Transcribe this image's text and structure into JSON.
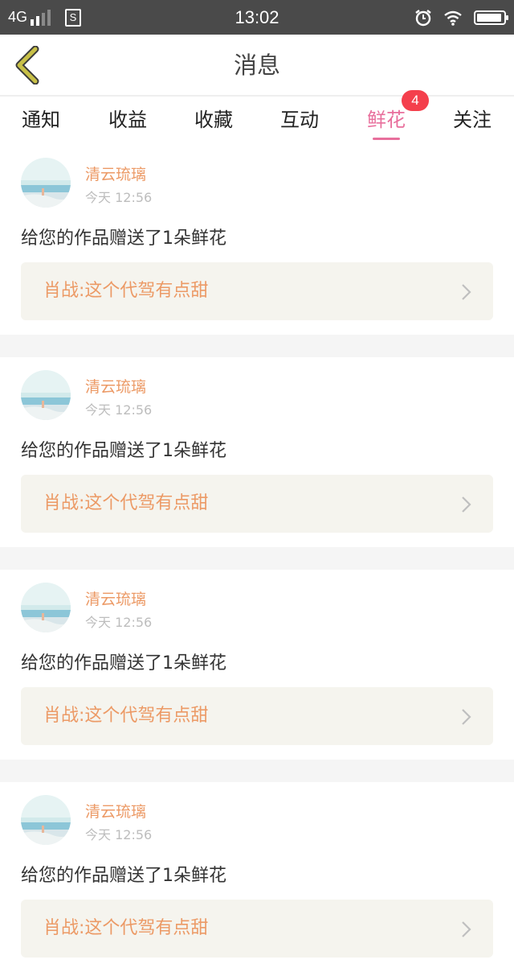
{
  "status_bar": {
    "network": "4G",
    "sim_label": "S",
    "time": "13:02",
    "icons": [
      "signal-icon",
      "sim-icon",
      "alarm-icon",
      "wifi-icon",
      "battery-icon"
    ],
    "battery_level": 0.95
  },
  "header": {
    "title": "消息",
    "back_icon": "chevron-left-icon",
    "back_color": "#c8c047"
  },
  "tabs": [
    {
      "label": "通知"
    },
    {
      "label": "收益"
    },
    {
      "label": "收藏"
    },
    {
      "label": "互动"
    },
    {
      "label": "鲜花",
      "badge": "4",
      "active": true
    },
    {
      "label": "关注"
    }
  ],
  "colors": {
    "accent": "#e86f9c",
    "badge": "#f43f4c",
    "username": "#ec9a66",
    "link_bg": "#f5f4ee"
  },
  "messages": [
    {
      "username": "清云琉璃",
      "time": "今天 12:56",
      "text": "给您的作品赠送了1朵鲜花",
      "work_title": "肖战:这个代驾有点甜"
    },
    {
      "username": "清云琉璃",
      "time": "今天 12:56",
      "text": "给您的作品赠送了1朵鲜花",
      "work_title": "肖战:这个代驾有点甜"
    },
    {
      "username": "清云琉璃",
      "time": "今天 12:56",
      "text": "给您的作品赠送了1朵鲜花",
      "work_title": "肖战:这个代驾有点甜"
    },
    {
      "username": "清云琉璃",
      "time": "今天 12:56",
      "text": "给您的作品赠送了1朵鲜花",
      "work_title": "肖战:这个代驾有点甜"
    }
  ]
}
